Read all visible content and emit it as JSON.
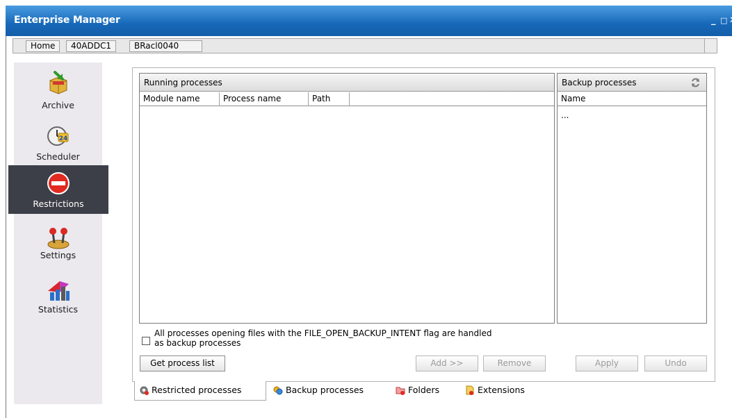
{
  "window": {
    "title": "Enterprise Manager",
    "minimize_glyph": "_",
    "maximize_glyph": "□",
    "close_glyph": "✕"
  },
  "breadcrumb": {
    "items": [
      "Home",
      "40ADDC1",
      "BRacl0040"
    ]
  },
  "sidebar": {
    "items": [
      {
        "label": "Archive",
        "icon": "archive-box-icon",
        "active": false
      },
      {
        "label": "Scheduler",
        "icon": "clock-24-icon",
        "active": false
      },
      {
        "label": "Restrictions",
        "icon": "no-entry-icon",
        "active": true
      },
      {
        "label": "Settings",
        "icon": "joystick-icon",
        "active": false
      },
      {
        "label": "Statistics",
        "icon": "statistics-chart-icon",
        "active": false
      }
    ]
  },
  "running_panel": {
    "title": "Running processes",
    "columns": [
      "Module name",
      "Process name",
      "Path"
    ],
    "rows": []
  },
  "backup_panel": {
    "title": "Backup processes",
    "refresh_icon": "refresh-icon",
    "columns": [
      "Name"
    ],
    "rows": [
      "..."
    ]
  },
  "checkbox": {
    "checked": false,
    "label_line1": "All processes opening files with the FILE_OPEN_BACKUP_INTENT flag are handled",
    "label_line2": "as backup processes"
  },
  "buttons": {
    "get_process_list": "Get process list",
    "add": "Add >>",
    "remove": "Remove",
    "apply": "Apply",
    "undo": "Undo"
  },
  "tabs": [
    {
      "label": "Restricted processes",
      "icon": "restricted-processes-icon",
      "active": true
    },
    {
      "label": "Backup processes",
      "icon": "backup-processes-icon",
      "active": false
    },
    {
      "label": "Folders",
      "icon": "folders-icon",
      "active": false
    },
    {
      "label": "Extensions",
      "icon": "extensions-icon",
      "active": false
    }
  ],
  "colors": {
    "titlebar": "#1768b9",
    "active_nav": "#3c3f48",
    "sidebar_bg": "#ebe9ee"
  }
}
